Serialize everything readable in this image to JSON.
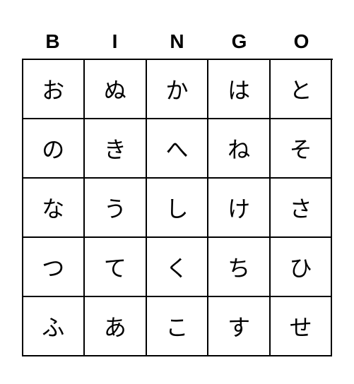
{
  "header": {
    "letters": [
      "B",
      "I",
      "N",
      "G",
      "O"
    ]
  },
  "grid": {
    "rows": [
      [
        "お",
        "ぬ",
        "か",
        "は",
        "と"
      ],
      [
        "の",
        "き",
        "へ",
        "ね",
        "そ"
      ],
      [
        "な",
        "う",
        "し",
        "け",
        "さ"
      ],
      [
        "つ",
        "て",
        "く",
        "ち",
        "ひ"
      ],
      [
        "ふ",
        "あ",
        "こ",
        "す",
        "せ"
      ]
    ]
  }
}
